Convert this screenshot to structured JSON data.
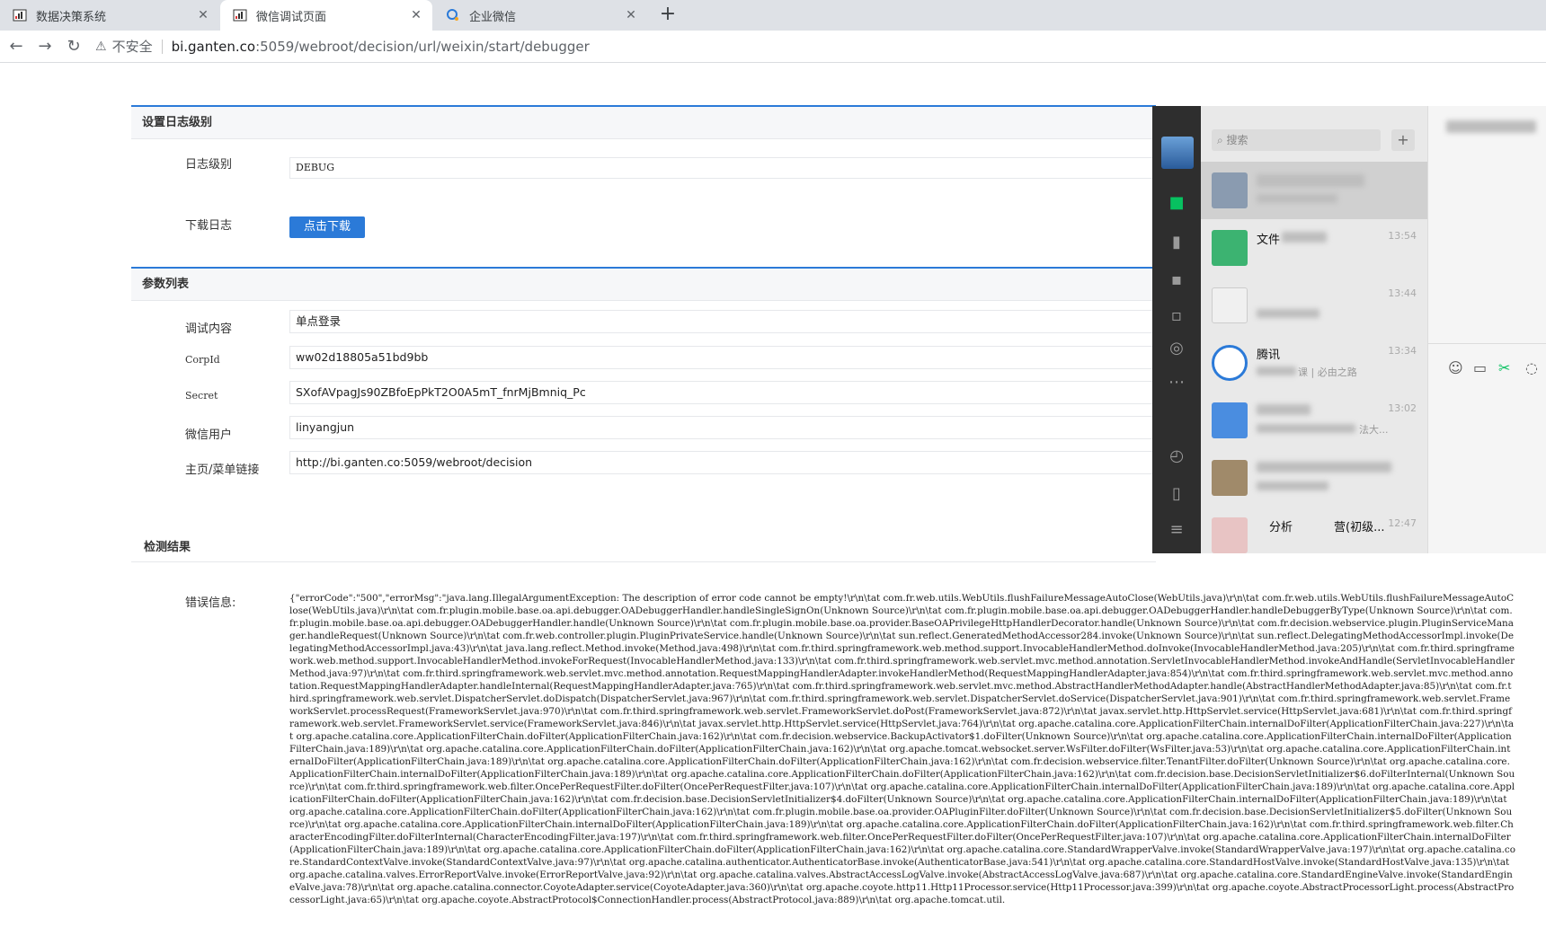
{
  "browser": {
    "tabs": [
      {
        "title": "数据决策系统",
        "active": false
      },
      {
        "title": "微信调试页面",
        "active": true
      },
      {
        "title": "企业微信",
        "active": false
      }
    ],
    "address": {
      "security": "不安全",
      "host": "bi.ganten.co",
      "path": ":5059/webroot/decision/url/weixin/start/debugger"
    }
  },
  "log_panel": {
    "title": "设置日志级别",
    "level_label": "日志级别",
    "level_value": "DEBUG",
    "download_label": "下载日志",
    "download_button": "点击下载"
  },
  "params_panel": {
    "title": "参数列表",
    "rows": [
      {
        "label": "调试内容",
        "value": "单点登录"
      },
      {
        "label": "CorpId",
        "value": "ww02d18805a51bd9bb"
      },
      {
        "label": "Secret",
        "value": "SXofAVpagJs90ZBfoEpPkT2O0A5mT_fnrMjBmniq_Pc"
      },
      {
        "label": "微信用户",
        "value": "linyangjun"
      },
      {
        "label": "主页/菜单链接",
        "value": "http://bi.ganten.co:5059/webroot/decision"
      }
    ]
  },
  "result": {
    "title": "检测结果",
    "error_label": "错误信息:",
    "error_text": "{\"errorCode\":\"500\",\"errorMsg\":\"java.lang.IllegalArgumentException: The description of error code cannot be empty!\\r\\n\\tat com.fr.web.utils.WebUtils.flushFailureMessageAutoClose(WebUtils.java)\\r\\n\\tat com.fr.web.utils.WebUtils.flushFailureMessageAutoClose(WebUtils.java)\\r\\n\\tat com.fr.plugin.mobile.base.oa.api.debugger.OADebuggerHandler.handleSingleSignOn(Unknown Source)\\r\\n\\tat com.fr.plugin.mobile.base.oa.api.debugger.OADebuggerHandler.handleDebuggerByType(Unknown Source)\\r\\n\\tat com.fr.plugin.mobile.base.oa.api.debugger.OADebuggerHandler.handle(Unknown Source)\\r\\n\\tat com.fr.plugin.mobile.base.oa.provider.BaseOAPrivilegeHttpHandlerDecorator.handle(Unknown Source)\\r\\n\\tat com.fr.decision.webservice.plugin.PluginServiceManager.handleRequest(Unknown Source)\\r\\n\\tat com.fr.web.controller.plugin.PluginPrivateService.handle(Unknown Source)\\r\\n\\tat sun.reflect.GeneratedMethodAccessor284.invoke(Unknown Source)\\r\\n\\tat sun.reflect.DelegatingMethodAccessorImpl.invoke(DelegatingMethodAccessorImpl.java:43)\\r\\n\\tat java.lang.reflect.Method.invoke(Method.java:498)\\r\\n\\tat com.fr.third.springframework.web.method.support.InvocableHandlerMethod.doInvoke(InvocableHandlerMethod.java:205)\\r\\n\\tat com.fr.third.springframework.web.method.support.InvocableHandlerMethod.invokeForRequest(InvocableHandlerMethod.java:133)\\r\\n\\tat com.fr.third.springframework.web.servlet.mvc.method.annotation.ServletInvocableHandlerMethod.invokeAndHandle(ServletInvocableHandlerMethod.java:97)\\r\\n\\tat com.fr.third.springframework.web.servlet.mvc.method.annotation.RequestMappingHandlerAdapter.invokeHandlerMethod(RequestMappingHandlerAdapter.java:854)\\r\\n\\tat com.fr.third.springframework.web.servlet.mvc.method.annotation.RequestMappingHandlerAdapter.handleInternal(RequestMappingHandlerAdapter.java:765)\\r\\n\\tat com.fr.third.springframework.web.servlet.mvc.method.AbstractHandlerMethodAdapter.handle(AbstractHandlerMethodAdapter.java:85)\\r\\n\\tat com.fr.third.springframework.web.servlet.DispatcherServlet.doDispatch(DispatcherServlet.java:967)\\r\\n\\tat com.fr.third.springframework.web.servlet.DispatcherServlet.doService(DispatcherServlet.java:901)\\r\\n\\tat com.fr.third.springframework.web.servlet.FrameworkServlet.processRequest(FrameworkServlet.java:970)\\r\\n\\tat com.fr.third.springframework.web.servlet.FrameworkServlet.doPost(FrameworkServlet.java:872)\\r\\n\\tat javax.servlet.http.HttpServlet.service(HttpServlet.java:681)\\r\\n\\tat com.fr.third.springframework.web.servlet.FrameworkServlet.service(FrameworkServlet.java:846)\\r\\n\\tat javax.servlet.http.HttpServlet.service(HttpServlet.java:764)\\r\\n\\tat org.apache.catalina.core.ApplicationFilterChain.internalDoFilter(ApplicationFilterChain.java:227)\\r\\n\\tat org.apache.catalina.core.ApplicationFilterChain.doFilter(ApplicationFilterChain.java:162)\\r\\n\\tat com.fr.decision.webservice.BackupActivator$1.doFilter(Unknown Source)\\r\\n\\tat org.apache.catalina.core.ApplicationFilterChain.internalDoFilter(ApplicationFilterChain.java:189)\\r\\n\\tat org.apache.catalina.core.ApplicationFilterChain.doFilter(ApplicationFilterChain.java:162)\\r\\n\\tat org.apache.tomcat.websocket.server.WsFilter.doFilter(WsFilter.java:53)\\r\\n\\tat org.apache.catalina.core.ApplicationFilterChain.internalDoFilter(ApplicationFilterChain.java:189)\\r\\n\\tat org.apache.catalina.core.ApplicationFilterChain.doFilter(ApplicationFilterChain.java:162)\\r\\n\\tat com.fr.decision.webservice.filter.TenantFilter.doFilter(Unknown Source)\\r\\n\\tat org.apache.catalina.core.ApplicationFilterChain.internalDoFilter(ApplicationFilterChain.java:189)\\r\\n\\tat org.apache.catalina.core.ApplicationFilterChain.doFilter(ApplicationFilterChain.java:162)\\r\\n\\tat com.fr.decision.base.DecisionServletInitializer$6.doFilterInternal(Unknown Source)\\r\\n\\tat com.fr.third.springframework.web.filter.OncePerRequestFilter.doFilter(OncePerRequestFilter.java:107)\\r\\n\\tat org.apache.catalina.core.ApplicationFilterChain.internalDoFilter(ApplicationFilterChain.java:189)\\r\\n\\tat org.apache.catalina.core.ApplicationFilterChain.doFilter(ApplicationFilterChain.java:162)\\r\\n\\tat com.fr.decision.base.DecisionServletInitializer$4.doFilter(Unknown Source)\\r\\n\\tat org.apache.catalina.core.ApplicationFilterChain.internalDoFilter(ApplicationFilterChain.java:189)\\r\\n\\tat org.apache.catalina.core.ApplicationFilterChain.doFilter(ApplicationFilterChain.java:162)\\r\\n\\tat com.fr.plugin.mobile.base.oa.provider.OAPluginFilter.doFilter(Unknown Source)\\r\\n\\tat com.fr.decision.base.DecisionServletInitializer$5.doFilter(Unknown Source)\\r\\n\\tat org.apache.catalina.core.ApplicationFilterChain.internalDoFilter(ApplicationFilterChain.java:189)\\r\\n\\tat org.apache.catalina.core.ApplicationFilterChain.doFilter(ApplicationFilterChain.java:162)\\r\\n\\tat com.fr.third.springframework.web.filter.CharacterEncodingFilter.doFilterInternal(CharacterEncodingFilter.java:197)\\r\\n\\tat com.fr.third.springframework.web.filter.OncePerRequestFilter.doFilter(OncePerRequestFilter.java:107)\\r\\n\\tat org.apache.catalina.core.ApplicationFilterChain.internalDoFilter(ApplicationFilterChain.java:189)\\r\\n\\tat org.apache.catalina.core.ApplicationFilterChain.doFilter(ApplicationFilterChain.java:162)\\r\\n\\tat org.apache.catalina.core.StandardWrapperValve.invoke(StandardWrapperValve.java:197)\\r\\n\\tat org.apache.catalina.core.StandardContextValve.invoke(StandardContextValve.java:97)\\r\\n\\tat org.apache.catalina.authenticator.AuthenticatorBase.invoke(AuthenticatorBase.java:541)\\r\\n\\tat org.apache.catalina.core.StandardHostValve.invoke(StandardHostValve.java:135)\\r\\n\\tat org.apache.catalina.valves.ErrorReportValve.invoke(ErrorReportValve.java:92)\\r\\n\\tat org.apache.catalina.valves.AbstractAccessLogValve.invoke(AbstractAccessLogValve.java:687)\\r\\n\\tat org.apache.catalina.core.StandardEngineValve.invoke(StandardEngineValve.java:78)\\r\\n\\tat org.apache.catalina.connector.CoyoteAdapter.service(CoyoteAdapter.java:360)\\r\\n\\tat org.apache.coyote.http11.Http11Processor.service(Http11Processor.java:399)\\r\\n\\tat org.apache.coyote.AbstractProcessorLight.process(AbstractProcessorLight.java:65)\\r\\n\\tat org.apache.coyote.AbstractProtocol$ConnectionHandler.process(AbstractProtocol.java:889)\\r\\n\\tat org.apache.tomcat.util."
  },
  "wechat": {
    "search_placeholder": "搜索",
    "chats": [
      {
        "name": "",
        "time": "",
        "msg": ""
      },
      {
        "name": "文件",
        "time": "13:54",
        "msg": ""
      },
      {
        "name": "",
        "time": "13:44",
        "msg": ""
      },
      {
        "name": "腾讯",
        "time": "13:34",
        "msg": "课 | 必由之路"
      },
      {
        "name": "",
        "time": "13:02",
        "msg": "法大..."
      },
      {
        "name": "",
        "time": "",
        "msg": ""
      },
      {
        "name": "分析",
        "time": "12:47",
        "msg": "营(初级..."
      }
    ]
  },
  "colors": {
    "accent": "#2b7ad8",
    "wechat_nav": "#2e2e2e",
    "wechat_green": "#07c160"
  }
}
